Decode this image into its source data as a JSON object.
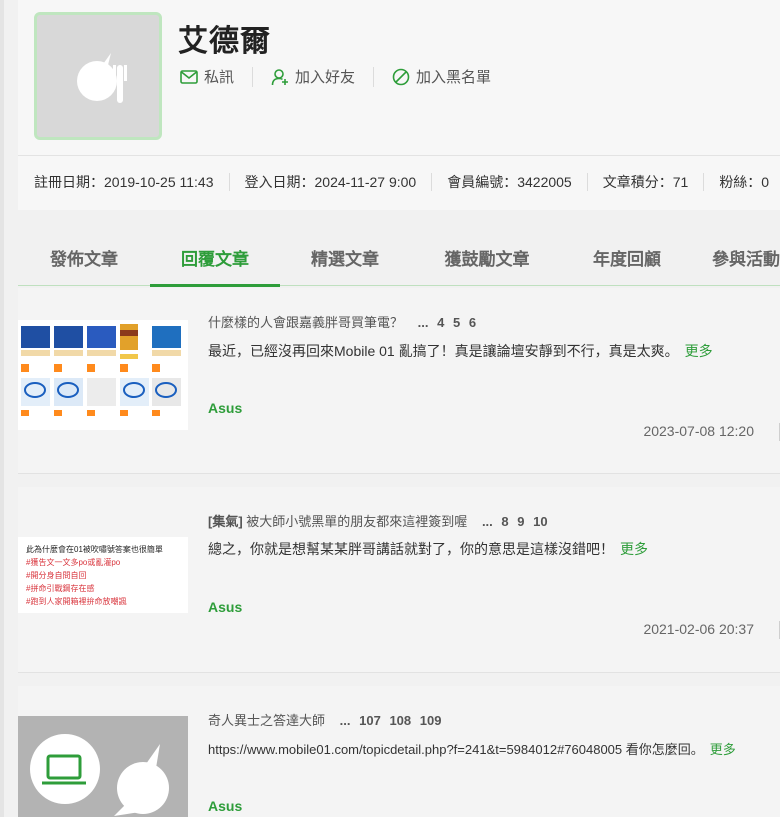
{
  "profile": {
    "username": "艾德爾",
    "actions": {
      "message": "私訊",
      "add_friend": "加入好友",
      "block": "加入黑名單"
    },
    "stats": {
      "registered": "註冊日期：2019-10-25 11:43",
      "last_login": "登入日期：2024-11-27 9:00",
      "member_no": "會員編號：3422005",
      "points": "文章積分：71",
      "fans": "粉絲：0"
    }
  },
  "tabs": [
    "發佈文章",
    "回覆文章",
    "精選文章",
    "獲鼓勵文章",
    "年度回顧",
    "參與活動"
  ],
  "active_tab": "回覆文章",
  "posts": [
    {
      "title": "什麼樣的人會跟嘉義胖哥買筆電？",
      "pages_prefix": "...",
      "pages": [
        "4",
        "5",
        "6"
      ],
      "excerpt": "最近，已經沒再回來Mobile 01 亂搞了！真是讓論壇安靜到不行，真是太爽。",
      "more": "更多",
      "forum": "Asus",
      "date": "2023-07-08 12:20"
    },
    {
      "title_tag": "[集氣]",
      "title": "被大師小號黑單的朋友都來這裡簽到喔",
      "pages_prefix": "...",
      "pages": [
        "8",
        "9",
        "10"
      ],
      "excerpt": "總之，你就是想幫某某胖哥講話就對了，你的意思是這樣沒錯吧！",
      "more": "更多",
      "forum": "Asus",
      "date": "2021-02-06 20:37",
      "thumb_lines": [
        "此為什麼會在01被吹嘯號答案也很簡單",
        "#獲告文一文多po或亂灌po",
        "#開分身自問自回",
        "#拼命引戰鋼存在感",
        "#跑到人家開箱裡拚命放嘲諷"
      ]
    },
    {
      "title": "奇人異士之答達大師",
      "pages_prefix": "...",
      "pages": [
        "107",
        "108",
        "109"
      ],
      "excerpt": "https://www.mobile01.com/topicdetail.php?f=241&t=5984012#76048005 看你怎麼回。",
      "more": "更多",
      "forum": "Asus"
    }
  ],
  "colors": {
    "accent": "#2e9d3a",
    "tag_red": "#d9363e"
  }
}
